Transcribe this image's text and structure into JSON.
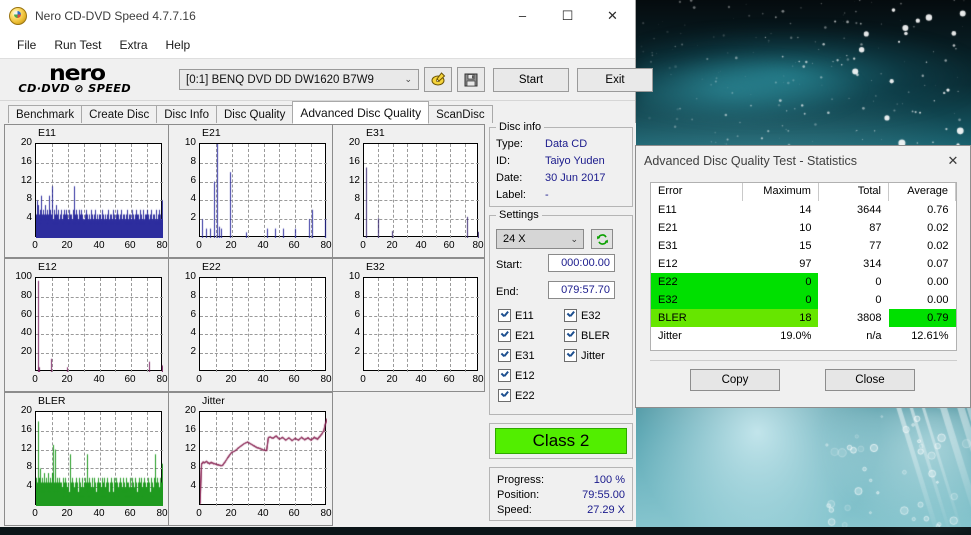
{
  "window": {
    "title": "Nero CD-DVD Speed 4.7.7.16",
    "minimize": "–",
    "maximize": "☐",
    "close": "✕"
  },
  "menubar": {
    "items": [
      "File",
      "Run Test",
      "Extra",
      "Help"
    ]
  },
  "toolbar": {
    "logo_top": "nero",
    "logo_bottom": "CD·DVD ⊘ SPEED",
    "drive_value": "[0:1]   BENQ DVD DD DW1620 B7W9",
    "drive_caret": "⌄",
    "disc_icon": "disc-speed-icon",
    "save_icon": "floppy-save-icon",
    "start_label": "Start",
    "exit_label": "Exit"
  },
  "tabs": {
    "items": [
      "Benchmark",
      "Create Disc",
      "Disc Info",
      "Disc Quality",
      "Advanced Disc Quality",
      "ScanDisc"
    ],
    "active": "Advanced Disc Quality"
  },
  "disc_info": {
    "legend": "Disc info",
    "rows": [
      {
        "key": "Type:",
        "value": "Data CD"
      },
      {
        "key": "ID:",
        "value": "Taiyo Yuden"
      },
      {
        "key": "Date:",
        "value": "30 Jun 2017"
      },
      {
        "key": "Label:",
        "value": "-"
      }
    ]
  },
  "settings": {
    "legend": "Settings",
    "speed": "24 X",
    "speed_caret": "⌄",
    "refresh_icon": "refresh-icon",
    "start_label": "Start:",
    "start_value": "000:00.00",
    "end_label": "End:",
    "end_value": "079:57.70",
    "checkboxes_left": [
      "E11",
      "E21",
      "E31",
      "E12",
      "E22"
    ],
    "checkboxes_right": [
      "E32",
      "BLER",
      "Jitter"
    ]
  },
  "class_badge": "Class 2",
  "status": {
    "rows": [
      {
        "key": "Progress:",
        "value": "100 %"
      },
      {
        "key": "Position:",
        "value": "79:55.00"
      },
      {
        "key": "Speed:",
        "value": "27.29 X"
      }
    ]
  },
  "stats_dialog": {
    "title": "Advanced Disc Quality Test - Statistics",
    "close_icon": "close-icon",
    "columns": [
      "Error",
      "Maximum",
      "Total",
      "Average"
    ],
    "rows": [
      {
        "error": "E11",
        "maximum": "14",
        "total": "3644",
        "average": "0.76",
        "highlight": "none"
      },
      {
        "error": "E21",
        "maximum": "10",
        "total": "87",
        "average": "0.02",
        "highlight": "none"
      },
      {
        "error": "E31",
        "maximum": "15",
        "total": "77",
        "average": "0.02",
        "highlight": "none"
      },
      {
        "error": "E12",
        "maximum": "97",
        "total": "314",
        "average": "0.07",
        "highlight": "none"
      },
      {
        "error": "E22",
        "maximum": "0",
        "total": "0",
        "average": "0.00",
        "highlight": "green-left"
      },
      {
        "error": "E32",
        "maximum": "0",
        "total": "0",
        "average": "0.00",
        "highlight": "green-left"
      },
      {
        "error": "BLER",
        "maximum": "18",
        "total": "3808",
        "average": "0.79",
        "highlight": "lime-left-green-avg"
      },
      {
        "error": "Jitter",
        "maximum": "19.0%",
        "total": "n/a",
        "average": "12.61%",
        "highlight": "none"
      }
    ],
    "copy_label": "Copy",
    "close_label": "Close"
  },
  "colors": {
    "green_bright": "#00E000",
    "green_lime": "#66E600",
    "class_badge": "#52EE00",
    "e11_series": "#2d2d9e",
    "bler_series": "#1f9a1f",
    "purple_series": "#7a2060",
    "jitter_series": "#8c2a58"
  },
  "chart_data": [
    {
      "type": "bar",
      "name": "E11",
      "title": "E11",
      "xlabel": "",
      "ylabel": "",
      "xlim": [
        0,
        80
      ],
      "ylim": [
        0,
        20
      ],
      "yticks": [
        4,
        8,
        12,
        16,
        20
      ],
      "xticks": [
        0,
        20,
        40,
        60,
        80
      ],
      "color": "#2d2d9e",
      "fill": true,
      "grid": true,
      "values": [
        3,
        5,
        8,
        4,
        6,
        3,
        7,
        2,
        4,
        3,
        5,
        2,
        6,
        4,
        3,
        5,
        9,
        4,
        3,
        2,
        5,
        4,
        3,
        6,
        4,
        2,
        5,
        3,
        7,
        4,
        2,
        3,
        5,
        2,
        4,
        6,
        3,
        2,
        5,
        4,
        9,
        3,
        5,
        2,
        4,
        6,
        3,
        2,
        5,
        4,
        3,
        11,
        5,
        2,
        4,
        3,
        6,
        2,
        4,
        5,
        3,
        2,
        7,
        4,
        3,
        5,
        2,
        4,
        3,
        6,
        2,
        5,
        3,
        4,
        2,
        3,
        5,
        4,
        2,
        3,
        6,
        4,
        2,
        3,
        5,
        2,
        4,
        3,
        6,
        2,
        4,
        3,
        5,
        2,
        3,
        4,
        6,
        2,
        3,
        5,
        4,
        2,
        3,
        6,
        2,
        4,
        3,
        5,
        2,
        4,
        3,
        2,
        5,
        3,
        4,
        2,
        6,
        3,
        2,
        4,
        11,
        3,
        2,
        5,
        4,
        3,
        2,
        6,
        4,
        2,
        3,
        5,
        2,
        4,
        3,
        2,
        6,
        3,
        4,
        2,
        5,
        3,
        2,
        4,
        6,
        2,
        3,
        5,
        4,
        2,
        3,
        2,
        4,
        3,
        5,
        2,
        4,
        3,
        2,
        6,
        3,
        2,
        4,
        5,
        3,
        2,
        4,
        3,
        2,
        5,
        4,
        3,
        2,
        6,
        3,
        2,
        4,
        3,
        5,
        2,
        3,
        4,
        2,
        5,
        3,
        2,
        4,
        3,
        6,
        2,
        3,
        4,
        2,
        5,
        3,
        2,
        4,
        3,
        2,
        5,
        3,
        4,
        2,
        3,
        5,
        2,
        4,
        3,
        2,
        6,
        3,
        2,
        4,
        5,
        3,
        2,
        4,
        3,
        2,
        5,
        3,
        4,
        2,
        3,
        5,
        2,
        4,
        3,
        6,
        2,
        3,
        4,
        2,
        5,
        3,
        2,
        4,
        3,
        5,
        2,
        4,
        3,
        2,
        6,
        3,
        2,
        4,
        3,
        5,
        2,
        3,
        4,
        2,
        5,
        3,
        2,
        6,
        4,
        3,
        2,
        5,
        3,
        4,
        2,
        3,
        5,
        2,
        4,
        3,
        2,
        6,
        3,
        4,
        2,
        5,
        3,
        2,
        4,
        3,
        5,
        2,
        4,
        3,
        2,
        5,
        3,
        4,
        2,
        6,
        3,
        2,
        4,
        3,
        5,
        2,
        4,
        3,
        2,
        5,
        3,
        4,
        2,
        3,
        6,
        2,
        4,
        3,
        5,
        2,
        3,
        4,
        2,
        5,
        3,
        2,
        4,
        6,
        3,
        2,
        5,
        3,
        4,
        2,
        3,
        5,
        2,
        4,
        3,
        2,
        6,
        4,
        3,
        2,
        5,
        3,
        4,
        2,
        3,
        5,
        2,
        6,
        4,
        3,
        2,
        5,
        3,
        4,
        2,
        3,
        5,
        2,
        4,
        3,
        6,
        2,
        3,
        5,
        4,
        2,
        3,
        5,
        2,
        4,
        3,
        2,
        6,
        3,
        4,
        2,
        5,
        3,
        2,
        4,
        3,
        5,
        2,
        4,
        3,
        2,
        6,
        3,
        5,
        4,
        2,
        3,
        5,
        2,
        4,
        3,
        2,
        6,
        3,
        4,
        5,
        3,
        2,
        4,
        3,
        5,
        8
      ]
    },
    {
      "type": "bar",
      "name": "E21",
      "title": "E21",
      "xlim": [
        0,
        80
      ],
      "ylim": [
        0,
        10
      ],
      "yticks": [
        2,
        4,
        6,
        8,
        10
      ],
      "xticks": [
        0,
        20,
        40,
        60,
        80
      ],
      "color": "#2d2d9e",
      "fill": false,
      "grid": true,
      "spikes": [
        {
          "x": 1.0,
          "y": 2.0
        },
        {
          "x": 3.5,
          "y": 1.0
        },
        {
          "x": 6.0,
          "y": 1.0
        },
        {
          "x": 9.0,
          "y": 6.0
        },
        {
          "x": 10.5,
          "y": 10.0
        },
        {
          "x": 12.0,
          "y": 1.2
        },
        {
          "x": 13.5,
          "y": 1.0
        },
        {
          "x": 19.0,
          "y": 7.0
        },
        {
          "x": 29.0,
          "y": 0.6
        },
        {
          "x": 42.5,
          "y": 1.0
        },
        {
          "x": 47.5,
          "y": 1.0
        },
        {
          "x": 52.0,
          "y": 1.0
        },
        {
          "x": 60.0,
          "y": 1.0
        },
        {
          "x": 68.5,
          "y": 2.0
        },
        {
          "x": 70.5,
          "y": 3.0
        },
        {
          "x": 79.0,
          "y": 2.0
        }
      ]
    },
    {
      "type": "bar",
      "name": "E31",
      "title": "E31",
      "xlim": [
        0,
        80
      ],
      "ylim": [
        0,
        20
      ],
      "yticks": [
        4,
        8,
        12,
        16,
        20
      ],
      "xticks": [
        0,
        20,
        40,
        60,
        80
      ],
      "color": "#3a2a70",
      "fill": false,
      "grid": true,
      "spikes": [
        {
          "x": 1.2,
          "y": 15.0
        },
        {
          "x": 9.5,
          "y": 4.2
        },
        {
          "x": 10.0,
          "y": 2.0
        },
        {
          "x": 19.5,
          "y": 1.5
        },
        {
          "x": 71.5,
          "y": 4.5
        },
        {
          "x": 79.5,
          "y": 1.3
        }
      ]
    },
    {
      "type": "bar",
      "name": "E12",
      "title": "E12",
      "xlim": [
        0,
        80
      ],
      "ylim": [
        0,
        100
      ],
      "yticks": [
        20,
        40,
        60,
        80,
        100
      ],
      "xticks": [
        0,
        20,
        40,
        60,
        80
      ],
      "color": "#7a2060",
      "fill": false,
      "grid": true,
      "spikes": [
        {
          "x": 1.2,
          "y": 97.0
        },
        {
          "x": 2.0,
          "y": 5.0
        },
        {
          "x": 9.5,
          "y": 14.0
        },
        {
          "x": 19.5,
          "y": 5.0
        },
        {
          "x": 71.0,
          "y": 11.0
        },
        {
          "x": 79.5,
          "y": 7.0
        }
      ]
    },
    {
      "type": "bar",
      "name": "E22",
      "title": "E22",
      "xlim": [
        0,
        80
      ],
      "ylim": [
        0,
        10
      ],
      "yticks": [
        2,
        4,
        6,
        8,
        10
      ],
      "xticks": [
        0,
        20,
        40,
        60,
        80
      ],
      "color": "#7a2060",
      "fill": false,
      "grid": true,
      "spikes": []
    },
    {
      "type": "bar",
      "name": "E32",
      "title": "E32",
      "xlim": [
        0,
        80
      ],
      "ylim": [
        0,
        10
      ],
      "yticks": [
        2,
        4,
        6,
        8,
        10
      ],
      "xticks": [
        0,
        20,
        40,
        60,
        80
      ],
      "color": "#7a2060",
      "fill": false,
      "grid": true,
      "spikes": []
    },
    {
      "type": "bar",
      "name": "BLER",
      "title": "BLER",
      "xlim": [
        0,
        80
      ],
      "ylim": [
        0,
        20
      ],
      "yticks": [
        4,
        8,
        12,
        16,
        20
      ],
      "xticks": [
        0,
        20,
        40,
        60,
        80
      ],
      "color": "#1f9a1f",
      "fill": true,
      "grid": true,
      "values": [
        4,
        6,
        5,
        3,
        18,
        7,
        5,
        4,
        6,
        3,
        8,
        5,
        4,
        3,
        6,
        4,
        5,
        3,
        7,
        4,
        3,
        5,
        4,
        2,
        6,
        3,
        5,
        4,
        7,
        3,
        5,
        4,
        3,
        6,
        4,
        2,
        5,
        3,
        7,
        4,
        12,
        13,
        5,
        3,
        12,
        6,
        4,
        3,
        5,
        4,
        6,
        3,
        5,
        4,
        2,
        6,
        3,
        5,
        4,
        3,
        5,
        2,
        4,
        3,
        6,
        2,
        5,
        3,
        4,
        2,
        6,
        3,
        5,
        4,
        2,
        3,
        5,
        4,
        2,
        3,
        11,
        10,
        5,
        3,
        4,
        2,
        6,
        3,
        5,
        4,
        2,
        3,
        5,
        4,
        2,
        6,
        3,
        5,
        4,
        2,
        3,
        6,
        4,
        2,
        5,
        3,
        4,
        2,
        6,
        3,
        5,
        4,
        2,
        3,
        5,
        4,
        2,
        6,
        3,
        5,
        11,
        4,
        3,
        5,
        2,
        6,
        4,
        3,
        5,
        2,
        4,
        3,
        6,
        2,
        5,
        3,
        4,
        2,
        6,
        3,
        5,
        4,
        2,
        3,
        5,
        4,
        2,
        6,
        3,
        5,
        4,
        2,
        3,
        5,
        4,
        2,
        6,
        3,
        5,
        4,
        2,
        3,
        6,
        4,
        2,
        5,
        3,
        4,
        2,
        6,
        3,
        5,
        4,
        2,
        3,
        5,
        4,
        2,
        6,
        3,
        5,
        4,
        2,
        3,
        6,
        4,
        2,
        5,
        3,
        4,
        2,
        6,
        3,
        5,
        4,
        2,
        3,
        5,
        4,
        2,
        6,
        3,
        5,
        4,
        2,
        3,
        6,
        4,
        2,
        5,
        3,
        4,
        2,
        6,
        3,
        5,
        4,
        2,
        3,
        5,
        4,
        2,
        6,
        3,
        5,
        4,
        2,
        3,
        6,
        4,
        2,
        5,
        3,
        4,
        2,
        6,
        3,
        5,
        4,
        2,
        3,
        5,
        4,
        2,
        6,
        3,
        5,
        4,
        2,
        3,
        6,
        4,
        2,
        5,
        3,
        4,
        2,
        6,
        3,
        5,
        4,
        2,
        3,
        5,
        4,
        2,
        6,
        3,
        5,
        4,
        2,
        3,
        6,
        4,
        2,
        5,
        3,
        4,
        2,
        6,
        3,
        5,
        11,
        4,
        3,
        5,
        2,
        6,
        4,
        3,
        5,
        2,
        4,
        3,
        6,
        2,
        5,
        3,
        4,
        9
      ]
    },
    {
      "type": "line",
      "name": "Jitter",
      "title": "Jitter",
      "xlim": [
        0,
        80
      ],
      "ylim": [
        0,
        20
      ],
      "yticks": [
        4,
        8,
        12,
        16,
        20
      ],
      "xticks": [
        0,
        20,
        40,
        60,
        80
      ],
      "color": "#8c2a58",
      "grid": true,
      "x": [
        0,
        1,
        2,
        3,
        4,
        5,
        6,
        7,
        8,
        9,
        10,
        11,
        12,
        13,
        14,
        15,
        16,
        17,
        18,
        19,
        20,
        22,
        24,
        26,
        28,
        30,
        32,
        34,
        36,
        38,
        40,
        42,
        43,
        44,
        46,
        48,
        50,
        52,
        54,
        56,
        58,
        60,
        62,
        64,
        66,
        68,
        70,
        72,
        74,
        76,
        78,
        79,
        80
      ],
      "y": [
        0.5,
        9.0,
        9.3,
        9.2,
        9.5,
        9.2,
        9.0,
        9.3,
        9.1,
        9.0,
        8.9,
        8.8,
        8.7,
        8.6,
        8.6,
        9.0,
        9.5,
        10.0,
        10.5,
        11.0,
        11.4,
        11.7,
        12.3,
        12.8,
        13.3,
        13.6,
        13.2,
        12.8,
        12.4,
        12.2,
        11.9,
        11.8,
        14.5,
        14.7,
        14.4,
        14.9,
        14.2,
        14.6,
        14.0,
        14.5,
        13.9,
        14.4,
        14.0,
        14.6,
        14.1,
        14.5,
        14.0,
        14.6,
        14.2,
        15.0,
        16.0,
        17.5,
        18.5
      ]
    }
  ]
}
